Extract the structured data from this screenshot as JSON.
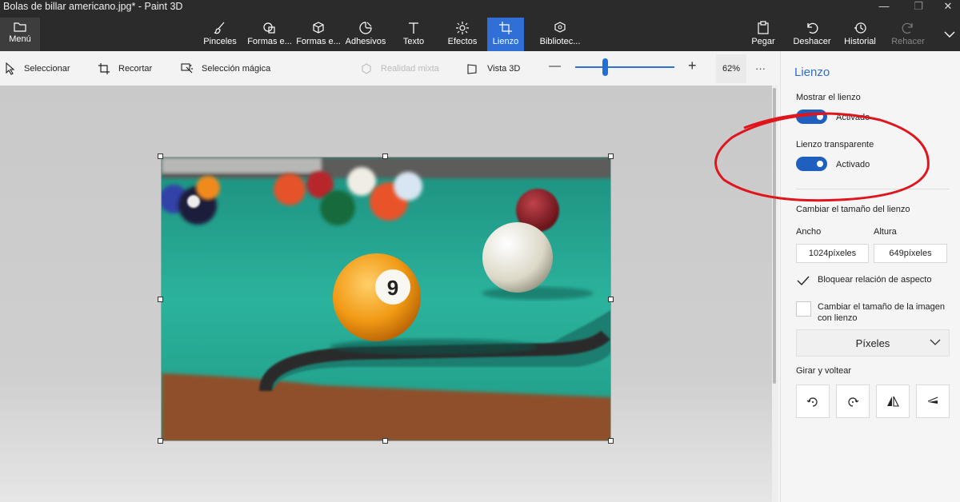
{
  "window": {
    "title": "Bolas de billar americano.jpg* - Paint 3D",
    "minimize_glyph": "—",
    "maximize_glyph": "❐",
    "close_glyph": "✕"
  },
  "menu": {
    "label": "Menú",
    "icon": "folder-icon"
  },
  "toolbar": {
    "tools": [
      {
        "label": "Pinceles",
        "icon": "brush-icon"
      },
      {
        "label": "Formas e...",
        "icon": "shapes-2d-icon"
      },
      {
        "label": "Formas e...",
        "icon": "cube-icon"
      },
      {
        "label": "Adhesivos",
        "icon": "sticker-icon"
      },
      {
        "label": "Texto",
        "icon": "text-icon"
      },
      {
        "label": "Efectos",
        "icon": "sun-icon"
      },
      {
        "label": "Lienzo",
        "icon": "crop-canvas-icon"
      },
      {
        "label": "Bibliotec...",
        "icon": "library-icon"
      }
    ],
    "right_tools": [
      {
        "label": "Pegar",
        "icon": "paste-icon"
      },
      {
        "label": "Deshacer",
        "icon": "undo-icon"
      },
      {
        "label": "Historial",
        "icon": "history-icon"
      },
      {
        "label": "Rehacer",
        "icon": "redo-icon"
      }
    ],
    "active_color": "#2f6fd6"
  },
  "subtoolbar": {
    "select": "Seleccionar",
    "crop": "Recortar",
    "magic_select": "Selección mágica",
    "mixed_reality": "Realidad mixta",
    "view_3d": "Vista 3D",
    "zoom_minus": "—",
    "zoom_plus": "+",
    "zoom_value": "62%",
    "zoom_level": 0.3,
    "more": "···"
  },
  "panel": {
    "title": "Lienzo",
    "show_canvas": {
      "label": "Mostrar el lienzo",
      "state": "Activado"
    },
    "transparent_canvas": {
      "label": "Lienzo transparente",
      "state": "Activado"
    },
    "resize_heading": "Cambiar el tamaño del lienzo",
    "width": {
      "label": "Ancho",
      "value": "1024píxeles"
    },
    "height": {
      "label": "Altura",
      "value": "649píxeles"
    },
    "lock_aspect": {
      "label": "Bloquear relación de aspecto",
      "checked": true
    },
    "resize_image": {
      "label_line1": "Cambiar el tamaño de la imagen",
      "label_line2": "con lienzo",
      "checked": false
    },
    "units": "Píxeles",
    "rotate_heading": "Girar y voltear",
    "rotate_buttons": [
      "rotate-left-icon",
      "rotate-right-icon",
      "flip-horizontal-icon",
      "flip-vertical-icon"
    ],
    "accent_color": "#1f5fbf",
    "annotation_color": "#e0151b"
  }
}
